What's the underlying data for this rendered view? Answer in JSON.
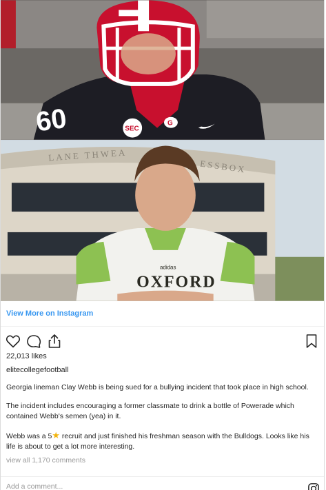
{
  "link": {
    "label": "View More on Instagram"
  },
  "post": {
    "likes": "22,013 likes",
    "username": "elitecollegefootball",
    "caption": {
      "p1": "Georgia lineman Clay Webb is being sued for a bullying incident that took place in high school.",
      "p2": "The incident includes encouraging a former classmate to drink a bottle of Powerade which contained Webb's semen (yea) in it.",
      "p3_pre": "Webb was a 5",
      "p3_post": " recruit and just finished his freshman season with the Bulldogs. Looks like his life is about to get a lot more interesting."
    },
    "view_comments": "view all 1,170 comments",
    "add_comment_placeholder": "Add a comment..."
  },
  "icons": {
    "like": "heart-icon",
    "comment": "comment-icon",
    "share": "share-icon",
    "save": "bookmark-icon",
    "brand": "instagram-icon",
    "star": "star-icon"
  },
  "colors": {
    "link": "#3897f0",
    "text": "#262626",
    "muted": "#999999",
    "star": "#f2b40e"
  }
}
